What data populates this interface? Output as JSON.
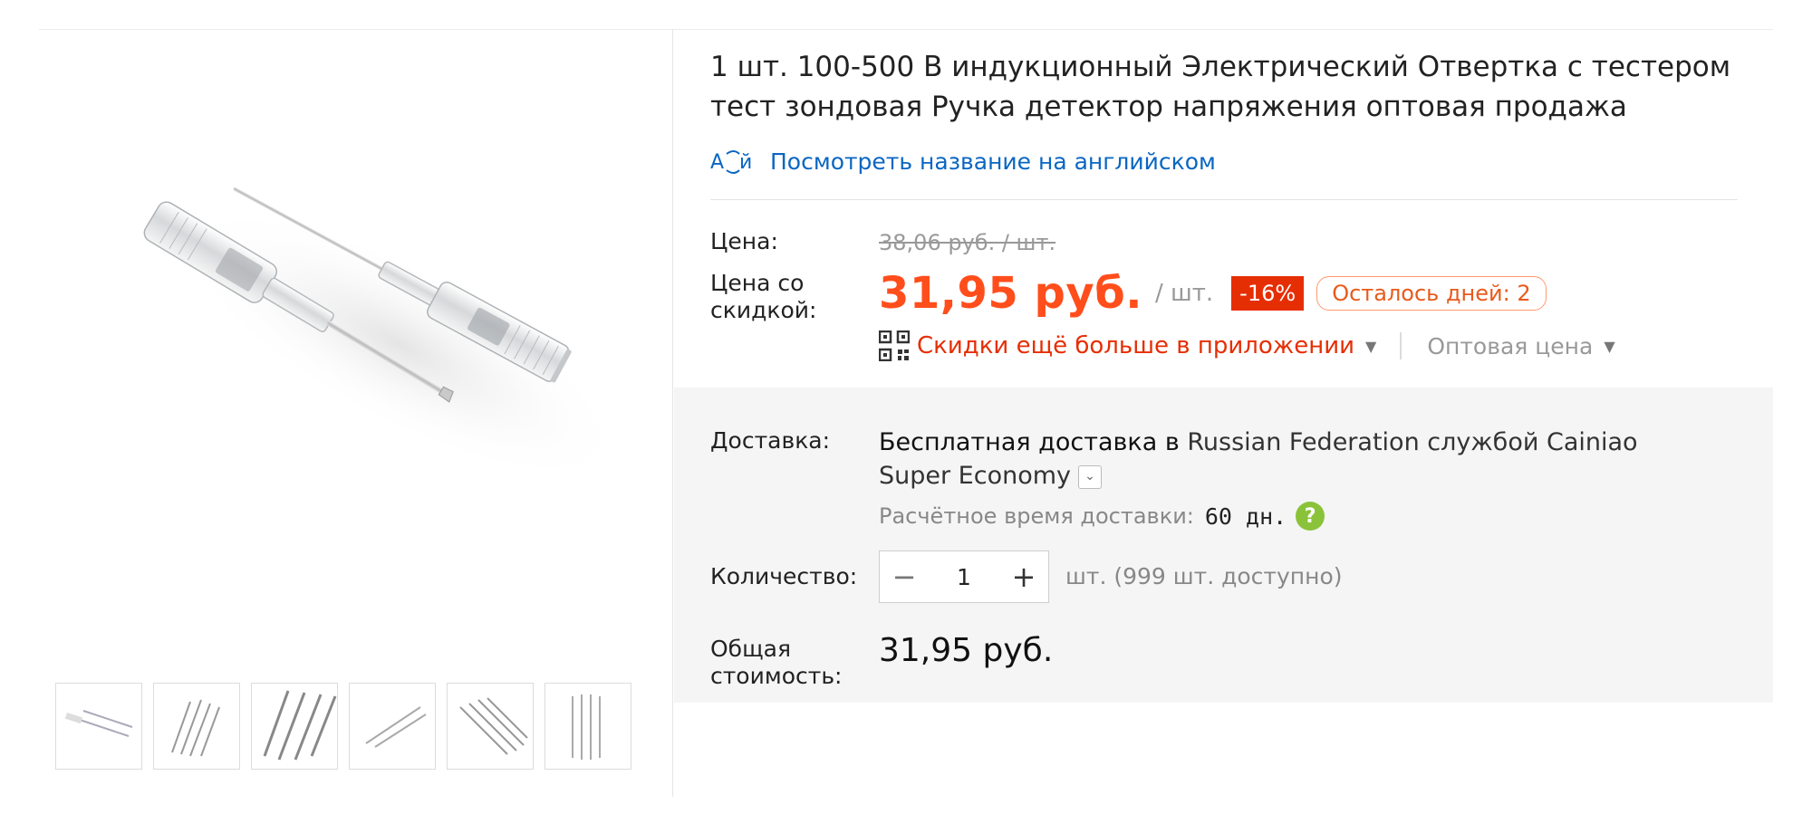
{
  "product": {
    "title": "1 шт. 100-500 В индукционный Электрический Отвертка с тестером тест зондовая Ручка детектор напряжения оптовая продажа",
    "translate_link": "Посмотреть название на английском",
    "translate_icon_text": "А й"
  },
  "price": {
    "label": "Цена:",
    "original": "38,06 руб. / шт.",
    "discount_label": "Цена со скидкой:",
    "current": "31,95 руб.",
    "unit": "/ шт.",
    "discount_percent": "-16%",
    "days_left": "Осталось дней: 2",
    "app_discount": "Скидки ещё больше в приложении",
    "wholesale": "Оптовая цена"
  },
  "shipping": {
    "label": "Доставка:",
    "free_text": "Бесплатная доставка в",
    "destination_and_service": "Russian Federation службой Cainiao Super Economy",
    "eta_label": "Расчётное время доставки:",
    "eta_value": "60 дн."
  },
  "quantity": {
    "label": "Количество:",
    "value": "1",
    "available": "шт. (999 шт. доступно)"
  },
  "total": {
    "label": "Общая стоимость:",
    "value": "31,95 руб."
  },
  "gallery": {
    "thumbnail_count": 6
  },
  "colors": {
    "price_accent": "#ff4e1b",
    "discount_badge": "#e62e04",
    "link_blue": "#0a66c2",
    "help_green": "#8ac33a"
  }
}
